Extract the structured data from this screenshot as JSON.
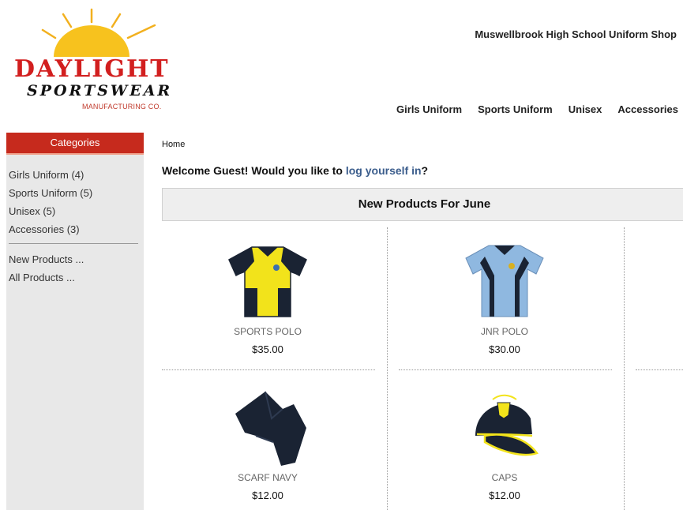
{
  "brand": {
    "line1": "DAYLIGHT",
    "line2": "SPORTSWEAR",
    "line3": "MANUFACTURING CO."
  },
  "shop_name": "Muswellbrook High School Uniform Shop",
  "top_nav": [
    "Girls Uniform",
    "Sports Uniform",
    "Unisex",
    "Accessories"
  ],
  "sidebar": {
    "header": "Categories",
    "categories": [
      "Girls Uniform (4)",
      "Sports Uniform (5)",
      "Unisex (5)",
      "Accessories (3)"
    ],
    "links": [
      "New Products ...",
      "All Products ..."
    ]
  },
  "breadcrumb": "Home",
  "welcome": {
    "prefix": "Welcome Guest! Would you like to ",
    "link": "log yourself in",
    "suffix": "?"
  },
  "section_title": "New Products For June",
  "products": [
    {
      "name": "SPORTS POLO",
      "price": "$35.00",
      "icon": "yellow-navy-polo-shirt"
    },
    {
      "name": "JNR POLO",
      "price": "$30.00",
      "icon": "light-blue-polo-shirt"
    },
    {
      "name": "SCARF NAVY",
      "price": "$12.00",
      "icon": "navy-scarf"
    },
    {
      "name": "CAPS",
      "price": "$12.00",
      "icon": "navy-yellow-cap"
    }
  ],
  "colors": {
    "accent_red": "#c62a1d",
    "link_blue": "#3b5d8c",
    "navy": "#1a2333",
    "yellow": "#f2e31b",
    "light_blue": "#8fb8e0"
  }
}
